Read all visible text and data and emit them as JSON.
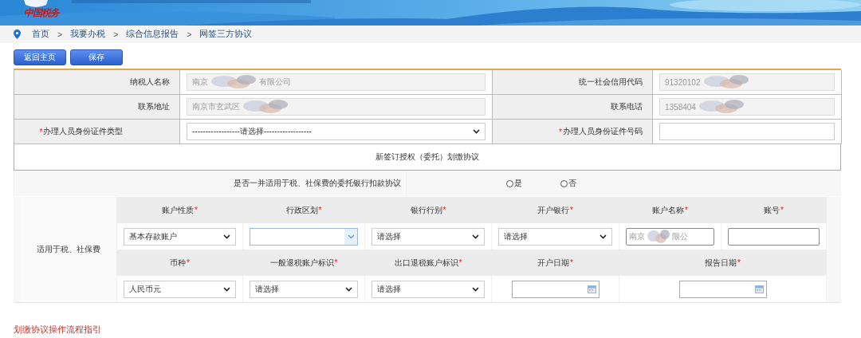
{
  "banner": {
    "logo_text": "中国税务"
  },
  "breadcrumb": {
    "separator": ">",
    "items": [
      "首页",
      "我要办税",
      "综合信息报告",
      "网签三方协议"
    ]
  },
  "buttons": [
    "返回主页",
    "保存"
  ],
  "info_rows": [
    [
      {
        "label": "纳税人名称",
        "kind": "readonly",
        "value_parts": [
          "南京",
          "有限公司"
        ]
      },
      {
        "label": "统一社会信用代码",
        "kind": "readonly",
        "value_parts": [
          "91320102"
        ]
      }
    ],
    [
      {
        "label": "联系地址",
        "kind": "readonly",
        "value_parts": [
          "南京市玄武区"
        ]
      },
      {
        "label": "联系电话",
        "kind": "readonly",
        "value_parts": [
          "1358404"
        ]
      }
    ],
    [
      {
        "label": "办理人员身份证件类型",
        "required_mark": "*",
        "kind": "select",
        "value": "------------------请选择------------------"
      },
      {
        "label": "办理人员身份证件号码",
        "required_mark": "*",
        "kind": "text"
      }
    ]
  ],
  "section_title": "新签订授权（委托）划缴协议",
  "question": {
    "text": "是否一并适用于税、社保费的委托银行扣款协议",
    "options": [
      {
        "label": "是",
        "selected": false
      },
      {
        "label": "否",
        "selected": false
      }
    ]
  },
  "account": {
    "label": "适用于税、社保费",
    "rows": [
      {
        "headers": [
          {
            "label": "账户性质",
            "required_mark": "*"
          },
          {
            "label": "行政区划",
            "required_mark": "*"
          },
          {
            "label": "银行行别",
            "required_mark": "*"
          },
          {
            "label": "开户银行",
            "required_mark": "*"
          },
          {
            "label": "账户名称",
            "required_mark": "*"
          },
          {
            "label": "账号",
            "required_mark": "*"
          }
        ],
        "inputs": [
          {
            "kind": "select",
            "value": "基本存款账户"
          },
          {
            "kind": "combo"
          },
          {
            "kind": "select",
            "value": "请选择"
          },
          {
            "kind": "select",
            "value": "请选择"
          },
          {
            "kind": "text",
            "value_parts": [
              "南京",
              "限公"
            ]
          },
          {
            "kind": "text"
          }
        ]
      },
      {
        "headers": [
          {
            "label": "币种",
            "required_mark": "*"
          },
          {
            "label": "一般退税账户标识",
            "required_mark": "*"
          },
          {
            "label": "出口退税账户标识",
            "required_mark": "*"
          },
          {
            "label": "开户日期",
            "required_mark": "*"
          },
          {
            "label": "报告日期",
            "required_mark": "*"
          }
        ],
        "inputs": [
          {
            "kind": "select",
            "value": "人民币元"
          },
          {
            "kind": "select",
            "value": "请选择"
          },
          {
            "kind": "select",
            "value": "请选择"
          },
          {
            "kind": "date"
          },
          {
            "kind": "date"
          }
        ]
      }
    ]
  },
  "guide_link": "划缴协议操作流程指引"
}
